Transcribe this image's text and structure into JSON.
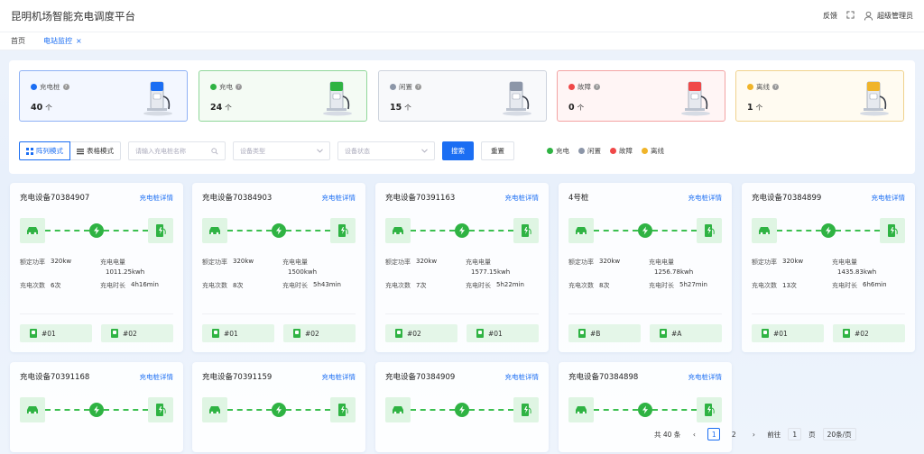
{
  "app": {
    "title": "昆明机场智能充电调度平台"
  },
  "topbar": {
    "feedback": "反馈",
    "user": "超级管理员"
  },
  "tabs": [
    {
      "label": "首页"
    },
    {
      "label": "电站监控"
    }
  ],
  "stats": [
    {
      "label": "充电桩",
      "count": "40",
      "unit": "个",
      "color": "#1b6ef3",
      "bg": "#f3f7ff",
      "border": "#8fb2f5"
    },
    {
      "label": "充电",
      "count": "24",
      "unit": "个",
      "color": "#2fb343",
      "bg": "#f4fbf4",
      "border": "#90d79a"
    },
    {
      "label": "闲置",
      "count": "15",
      "unit": "个",
      "color": "#8c96a8",
      "bg": "#f8f9fb",
      "border": "#cdd3dd"
    },
    {
      "label": "故障",
      "count": "0",
      "unit": "个",
      "color": "#f04848",
      "bg": "#fff5f5",
      "border": "#f3a3a3"
    },
    {
      "label": "离线",
      "count": "1",
      "unit": "个",
      "color": "#f0b429",
      "bg": "#fffbf1",
      "border": "#f0d28d"
    }
  ],
  "toolbar": {
    "grid_mode": "阵列模式",
    "table_mode": "表格模式",
    "search_placeholder": "请输入充电桩名称",
    "device_type": "设备类型",
    "device_status": "设备状态",
    "search": "搜索",
    "reset": "重置"
  },
  "legend": [
    {
      "label": "充电",
      "color": "#2fb343"
    },
    {
      "label": "闲置",
      "color": "#8c96a8"
    },
    {
      "label": "故障",
      "color": "#f04848"
    },
    {
      "label": "离线",
      "color": "#f0b429"
    }
  ],
  "card_labels": {
    "detail": "充电桩详情",
    "rated_power": "额定功率",
    "energy": "充电电量",
    "count": "充电次数",
    "duration": "充电时长"
  },
  "cards": [
    {
      "title": "充电设备70384907",
      "power": "320kw",
      "energy": "1011.25kwh",
      "count": "6次",
      "duration": "4h16min",
      "guns": [
        "#01",
        "#02"
      ]
    },
    {
      "title": "充电设备70384903",
      "power": "320kw",
      "energy": "1500kwh",
      "count": "8次",
      "duration": "5h43min",
      "guns": [
        "#01",
        "#02"
      ]
    },
    {
      "title": "充电设备70391163",
      "power": "320kw",
      "energy": "1577.15kwh",
      "count": "7次",
      "duration": "5h22min",
      "guns": [
        "#02",
        "#01"
      ]
    },
    {
      "title": "4号桩",
      "power": "320kw",
      "energy": "1256.78kwh",
      "count": "8次",
      "duration": "5h27min",
      "guns": [
        "#B",
        "#A"
      ]
    },
    {
      "title": "充电设备70384899",
      "power": "320kw",
      "energy": "1435.83kwh",
      "count": "13次",
      "duration": "6h6min",
      "guns": [
        "#01",
        "#02"
      ]
    },
    {
      "title": "充电设备70391168"
    },
    {
      "title": "充电设备70391159"
    },
    {
      "title": "充电设备70384909"
    },
    {
      "title": "充电设备70384898"
    }
  ],
  "pager": {
    "total": "共 40 条",
    "pages": [
      "1",
      "2"
    ],
    "goto": "前往",
    "page": "1",
    "page_unit": "页",
    "size": "20条/页"
  }
}
